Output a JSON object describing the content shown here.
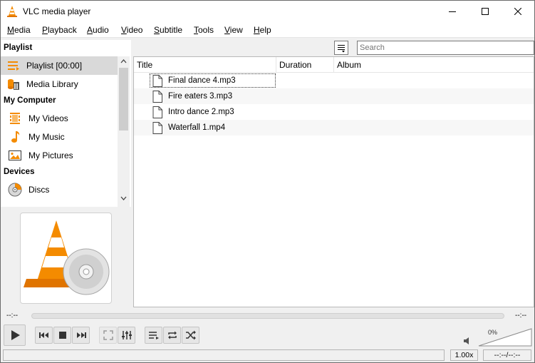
{
  "window": {
    "title": "VLC media player"
  },
  "menu": [
    {
      "mnemonic": "M",
      "rest": "edia"
    },
    {
      "mnemonic": "P",
      "rest": "layback"
    },
    {
      "mnemonic": "A",
      "rest": "udio"
    },
    {
      "mnemonic": "V",
      "rest": "ideo"
    },
    {
      "mnemonic": "S",
      "rest": "ubtitle"
    },
    {
      "mnemonic": "T",
      "rest": "ools"
    },
    {
      "mnemonic": "V",
      "rest": "iew"
    },
    {
      "mnemonic": "H",
      "rest": "elp"
    }
  ],
  "sidebar": {
    "playlist_header": "Playlist",
    "playlist_item": "Playlist [00:00]",
    "media_library": "Media Library",
    "computer_header": "My Computer",
    "my_videos": "My Videos",
    "my_music": "My Music",
    "my_pictures": "My Pictures",
    "devices_header": "Devices",
    "discs": "Discs"
  },
  "search": {
    "placeholder": "Search"
  },
  "playlist": {
    "columns": {
      "title": "Title",
      "duration": "Duration",
      "album": "Album"
    },
    "rows": [
      {
        "title": "Final dance 4.mp3"
      },
      {
        "title": "Fire eaters 3.mp3"
      },
      {
        "title": "Intro dance 2.mp3"
      },
      {
        "title": "Waterfall 1.mp4"
      }
    ]
  },
  "seek": {
    "elapsed": "--:--",
    "remaining": "--:--"
  },
  "volume": {
    "percent_label": "0%"
  },
  "status": {
    "speed": "1.00x",
    "time": "--:--/--:--"
  },
  "colors": {
    "accent_orange": "#f48b00",
    "selected": "#d9d9d9"
  }
}
